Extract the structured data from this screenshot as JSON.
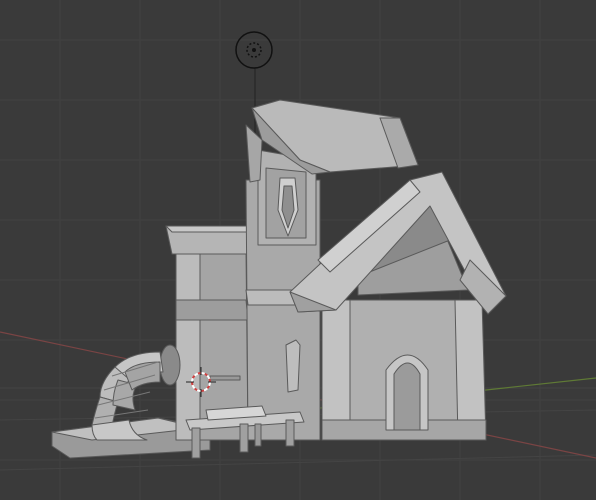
{
  "viewport": {
    "background_color": "#3a3a3a",
    "grid_color": "#404040",
    "x_axis_color": "#8a4a4a",
    "y_axis_color": "#6b8a3a",
    "model_color": "#b3b3b3",
    "model_shadow_color": "#8c8c8c",
    "model_dark_color": "#6f6f6f",
    "edge_color": "#555555"
  },
  "scene": {
    "light_gizmo": "point-light-icon",
    "cursor_gizmo": "3d-cursor-icon",
    "model": "house-mesh"
  }
}
